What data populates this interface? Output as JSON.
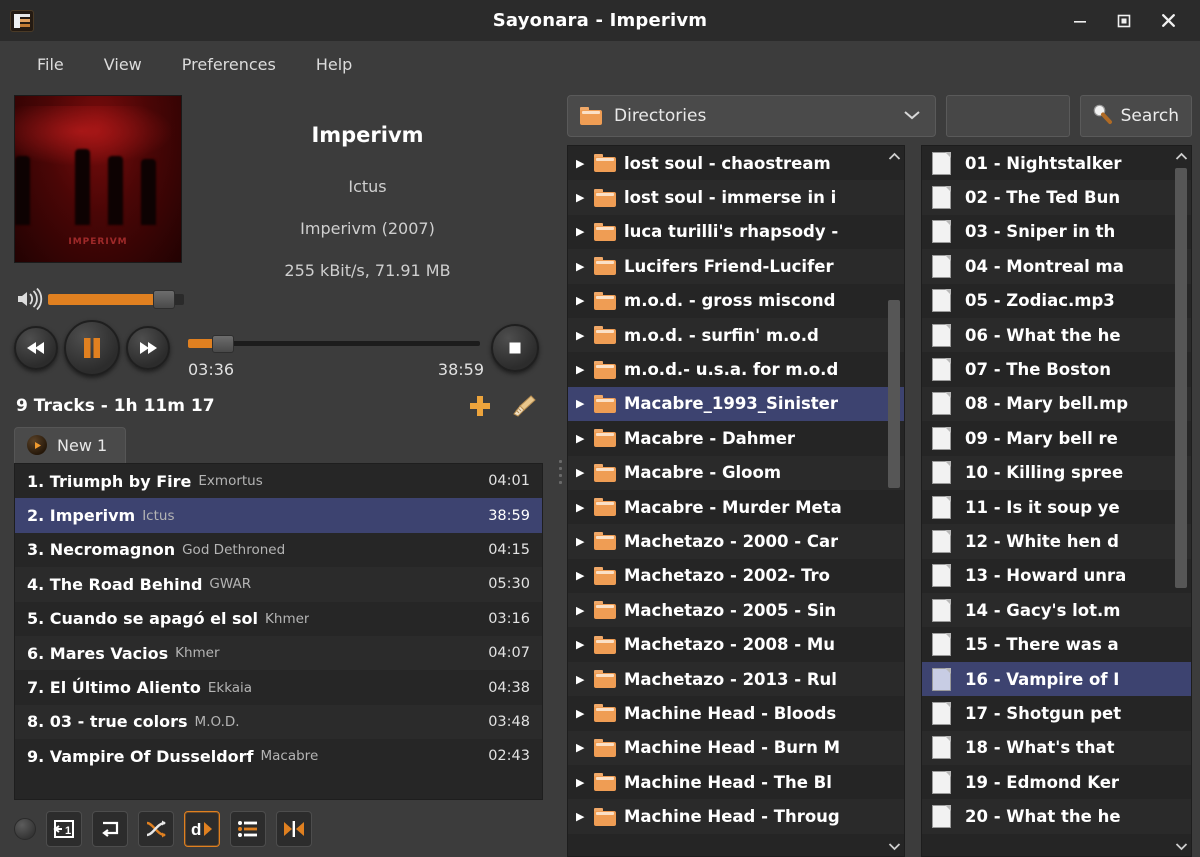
{
  "window": {
    "title": "Sayonara - Imperivm",
    "app_icon": "playlist-icon",
    "minimize": "minimize-icon",
    "maximize": "maximize-icon",
    "close": "close-icon"
  },
  "menubar": [
    {
      "label": "File"
    },
    {
      "label": "View"
    },
    {
      "label": "Preferences"
    },
    {
      "label": "Help"
    }
  ],
  "player": {
    "cover_caption": "IMPERIVM",
    "track_title": "Imperivm",
    "artist": "Ictus",
    "album": "Imperivm (2007)",
    "tech_info": "255 kBit/s, 71.91 MB",
    "volume_percent": 80,
    "elapsed": "03:36",
    "total": "38:59",
    "seek_percent": 9,
    "buttons": {
      "previous": "previous-icon",
      "play_pause": "pause-icon",
      "next": "next-icon",
      "stop": "stop-icon"
    }
  },
  "playlist": {
    "summary": "9 Tracks - 1h 11m 17",
    "add_label": "add-icon",
    "clear_label": "broom-icon",
    "tab_label": "New 1",
    "columns": [
      "index",
      "title",
      "artist",
      "length"
    ],
    "tracks": [
      {
        "index": "1.",
        "title": "Triumph by Fire",
        "artist": "Exmortus",
        "length": "04:01",
        "selected": false
      },
      {
        "index": "2.",
        "title": "Imperivm",
        "artist": "Ictus",
        "length": "38:59",
        "selected": true
      },
      {
        "index": "3.",
        "title": "Necromagnon",
        "artist": "God Dethroned",
        "length": "04:15",
        "selected": false
      },
      {
        "index": "4.",
        "title": "The Road Behind",
        "artist": "GWAR",
        "length": "05:30",
        "selected": false
      },
      {
        "index": "5.",
        "title": "Cuando se apagó el sol",
        "artist": "Khmer",
        "length": "03:16",
        "selected": false
      },
      {
        "index": "6.",
        "title": "Mares Vacios",
        "artist": "Khmer",
        "length": "04:07",
        "selected": false
      },
      {
        "index": "7.",
        "title": "El Último Aliento",
        "artist": "Ekkaia",
        "length": "04:38",
        "selected": false
      },
      {
        "index": "8.",
        "title": "03 - true colors",
        "artist": "M.O.D.",
        "length": "03:48",
        "selected": false
      },
      {
        "index": "9.",
        "title": "Vampire Of Dusseldorf",
        "artist": "Macabre",
        "length": "02:43",
        "selected": false
      }
    ],
    "toolbar": [
      {
        "name": "repeat-one-toggle",
        "icon": "repeat-1",
        "active": false
      },
      {
        "name": "repeat-all-toggle",
        "icon": "repeat-all",
        "active": false
      },
      {
        "name": "shuffle-toggle",
        "icon": "shuffle",
        "active": false
      },
      {
        "name": "dynamic-play-toggle",
        "icon": "dynamic-d",
        "active": true
      },
      {
        "name": "append-toggle",
        "icon": "list",
        "active": false
      },
      {
        "name": "gapless-toggle",
        "icon": "gapless",
        "active": false
      }
    ]
  },
  "library": {
    "mode_selector": {
      "icon": "folder-icon",
      "value": "Directories",
      "chevron": "chevron-down-icon"
    },
    "search": {
      "input_value": "",
      "placeholder": "",
      "button_label": "Search",
      "button_icon": "search-icon"
    },
    "directories": [
      {
        "name": "lost soul - chaostream",
        "selected": false
      },
      {
        "name": "lost soul - immerse in i",
        "selected": false
      },
      {
        "name": "luca turilli's rhapsody -",
        "selected": false
      },
      {
        "name": "Lucifers Friend-Lucifer",
        "selected": false
      },
      {
        "name": "m.o.d. - gross miscond",
        "selected": false
      },
      {
        "name": "m.o.d. - surfin' m.o.d",
        "selected": false
      },
      {
        "name": "m.o.d.- u.s.a. for m.o.d",
        "selected": false
      },
      {
        "name": "Macabre_1993_Sinister",
        "selected": true
      },
      {
        "name": "Macabre - Dahmer",
        "selected": false
      },
      {
        "name": "Macabre - Gloom",
        "selected": false
      },
      {
        "name": "Macabre - Murder Meta",
        "selected": false
      },
      {
        "name": "Machetazo - 2000 - Car",
        "selected": false
      },
      {
        "name": "Machetazo - 2002- Tro",
        "selected": false
      },
      {
        "name": "Machetazo - 2005 - Sin",
        "selected": false
      },
      {
        "name": "Machetazo - 2008 -  Mu",
        "selected": false
      },
      {
        "name": "Machetazo - 2013 - Rul",
        "selected": false
      },
      {
        "name": "Machine Head - Bloods",
        "selected": false
      },
      {
        "name": "Machine Head - Burn M",
        "selected": false
      },
      {
        "name": "Machine Head - The Bl",
        "selected": false
      },
      {
        "name": "Machine Head - Throug",
        "selected": false
      }
    ],
    "files": [
      {
        "name": "01 - Nightstalker",
        "selected": false
      },
      {
        "name": "02 - The Ted Bun",
        "selected": false
      },
      {
        "name": "03 - Sniper in th",
        "selected": false
      },
      {
        "name": "04 - Montreal ma",
        "selected": false
      },
      {
        "name": "05 - Zodiac.mp3",
        "selected": false
      },
      {
        "name": "06 - What the he",
        "selected": false
      },
      {
        "name": "07 - The Boston",
        "selected": false
      },
      {
        "name": "08 - Mary bell.mp",
        "selected": false
      },
      {
        "name": "09 - Mary bell re",
        "selected": false
      },
      {
        "name": "10 - Killing spree",
        "selected": false
      },
      {
        "name": "11 - Is it soup ye",
        "selected": false
      },
      {
        "name": "12 - White hen d",
        "selected": false
      },
      {
        "name": "13 - Howard unra",
        "selected": false
      },
      {
        "name": "14 - Gacy's lot.m",
        "selected": false
      },
      {
        "name": "15 - There was a",
        "selected": false
      },
      {
        "name": "16 - Vampire of I",
        "selected": true
      },
      {
        "name": "17 - Shotgun pet",
        "selected": false
      },
      {
        "name": "18 - What's that",
        "selected": false
      },
      {
        "name": "19 - Edmond Ker",
        "selected": false
      },
      {
        "name": "20 - What the he",
        "selected": false
      }
    ],
    "scroll_up_icon": "chevron-up-icon",
    "scroll_down_icon": "chevron-down-icon"
  },
  "colors": {
    "accent": "#e08020",
    "selection": "#3d4370",
    "window_bg": "#3c3c3c",
    "titlebar_bg": "#2b2b2b",
    "list_bg": "#252525"
  }
}
